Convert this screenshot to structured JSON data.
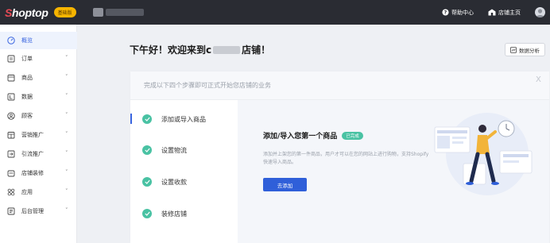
{
  "app": {
    "logo_s": "S",
    "logo_rest": "hoptop",
    "plan_badge": "基础版"
  },
  "header": {
    "help": "帮助中心",
    "store_home": "店铺主页"
  },
  "sidebar": {
    "items": [
      {
        "label": "概览",
        "icon": "dashboard-icon",
        "active": true
      },
      {
        "label": "订单",
        "icon": "orders-icon",
        "chevron": "˅"
      },
      {
        "label": "商品",
        "icon": "products-icon",
        "chevron": "˅"
      },
      {
        "label": "数据",
        "icon": "data-icon",
        "chevron": "˅"
      },
      {
        "label": "顾客",
        "icon": "customers-icon",
        "chevron": "˅"
      },
      {
        "label": "营销推广",
        "icon": "marketing-icon",
        "chevron": "˅"
      },
      {
        "label": "引流推广",
        "icon": "traffic-icon",
        "chevron": "˅"
      },
      {
        "label": "店铺装修",
        "icon": "store-design-icon",
        "chevron": "˅"
      },
      {
        "label": "应用",
        "icon": "apps-icon",
        "chevron": "˅"
      },
      {
        "label": "后台管理",
        "icon": "admin-icon",
        "chevron": "˅"
      }
    ]
  },
  "main": {
    "greeting_prefix": "下午好！欢迎来到c",
    "greeting_suffix": "店铺！",
    "analysis_button": "数据分析",
    "card_title": "完成以下四个步骤即可正式开始您店铺的业务",
    "close": "X",
    "steps": [
      {
        "label": "添加或导入商品",
        "active": true
      },
      {
        "label": "设置物流"
      },
      {
        "label": "设置收款"
      },
      {
        "label": "装修店铺"
      }
    ],
    "detail": {
      "title": "添加/导入您第一个商品",
      "badge": "已完成",
      "desc": "添加并上架您的第一件商品，用户才可以在您的网站上进行购物，支持Shopify快速导入商品。",
      "button": "去添加"
    }
  },
  "colors": {
    "accent": "#2f5fd9",
    "success": "#49c2a3",
    "topbar": "#2a2c33",
    "plan_badge": "#f7b500"
  }
}
